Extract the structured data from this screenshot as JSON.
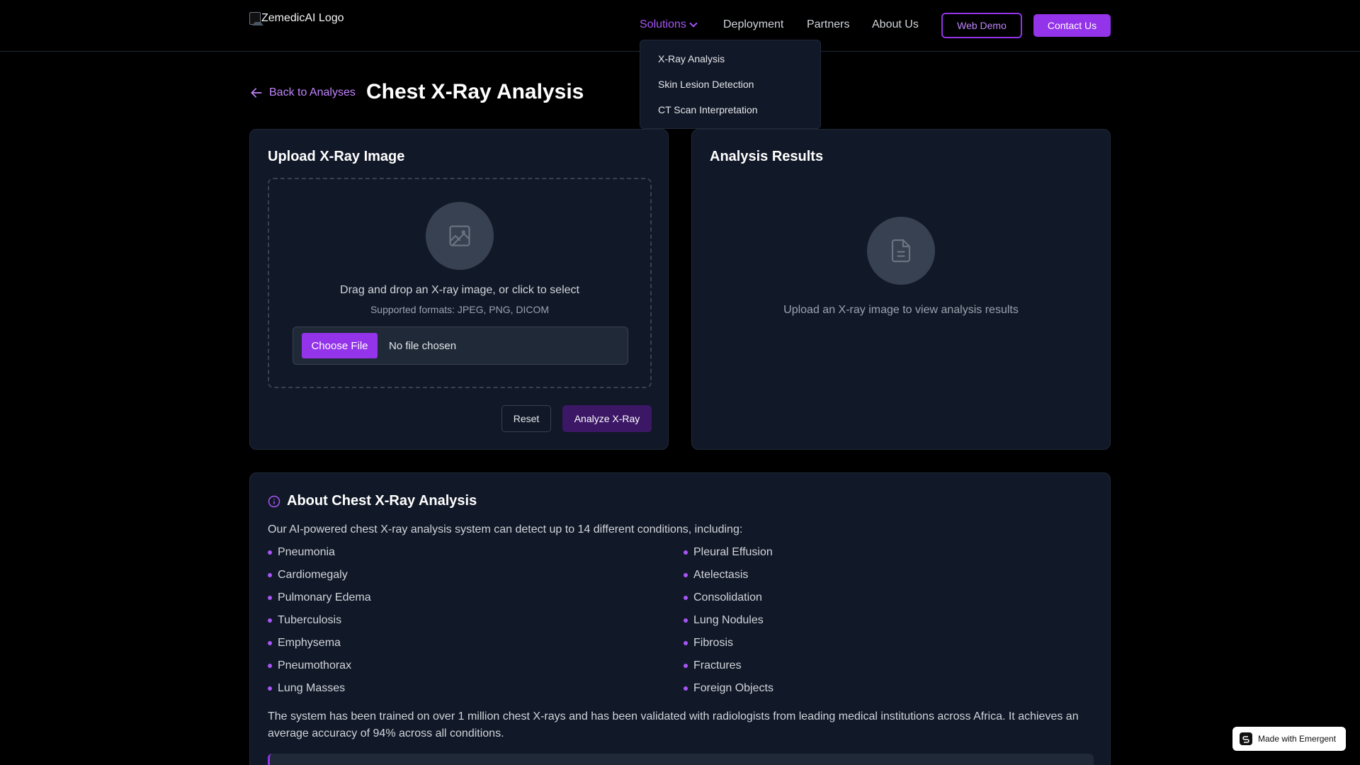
{
  "header": {
    "logo_alt": "ZemedicAI Logo",
    "nav": {
      "solutions": "Solutions",
      "deployment": "Deployment",
      "partners": "Partners",
      "about": "About Us"
    },
    "web_demo": "Web Demo",
    "contact": "Contact Us"
  },
  "dropdown": {
    "items": [
      "X-Ray Analysis",
      "Skin Lesion Detection",
      "CT Scan Interpretation"
    ]
  },
  "page": {
    "back_label": "Back to Analyses",
    "title": "Chest X-Ray Analysis"
  },
  "upload": {
    "title": "Upload X-Ray Image",
    "drop_text": "Drag and drop an X-ray image, or click to select",
    "formats": "Supported formats: JPEG, PNG, DICOM",
    "choose_file": "Choose File",
    "no_file": "No file chosen",
    "reset": "Reset",
    "analyze": "Analyze X-Ray"
  },
  "results": {
    "title": "Analysis Results",
    "empty_text": "Upload an X-ray image to view analysis results"
  },
  "about": {
    "title": "About Chest X-Ray Analysis",
    "intro": "Our AI-powered chest X-ray analysis system can detect up to 14 different conditions, including:",
    "conditions_left": [
      "Pneumonia",
      "Cardiomegaly",
      "Pulmonary Edema",
      "Tuberculosis",
      "Emphysema",
      "Pneumothorax",
      "Lung Masses"
    ],
    "conditions_right": [
      "Pleural Effusion",
      "Atelectasis",
      "Consolidation",
      "Lung Nodules",
      "Fibrosis",
      "Fractures",
      "Foreign Objects"
    ],
    "note": "The system has been trained on over 1 million chest X-rays and has been validated with radiologists from leading medical institutions across Africa. It achieves an average accuracy of 94% across all conditions."
  },
  "badge": {
    "label": "Made with Emergent"
  },
  "colors": {
    "accent": "#9333ea",
    "accent_light": "#c084fc",
    "card_bg": "#111827",
    "page_bg": "#000000"
  },
  "icons": [
    "chevron-down-icon",
    "arrow-left-icon",
    "image-icon",
    "document-icon",
    "info-icon",
    "emergent-logo-icon"
  ]
}
